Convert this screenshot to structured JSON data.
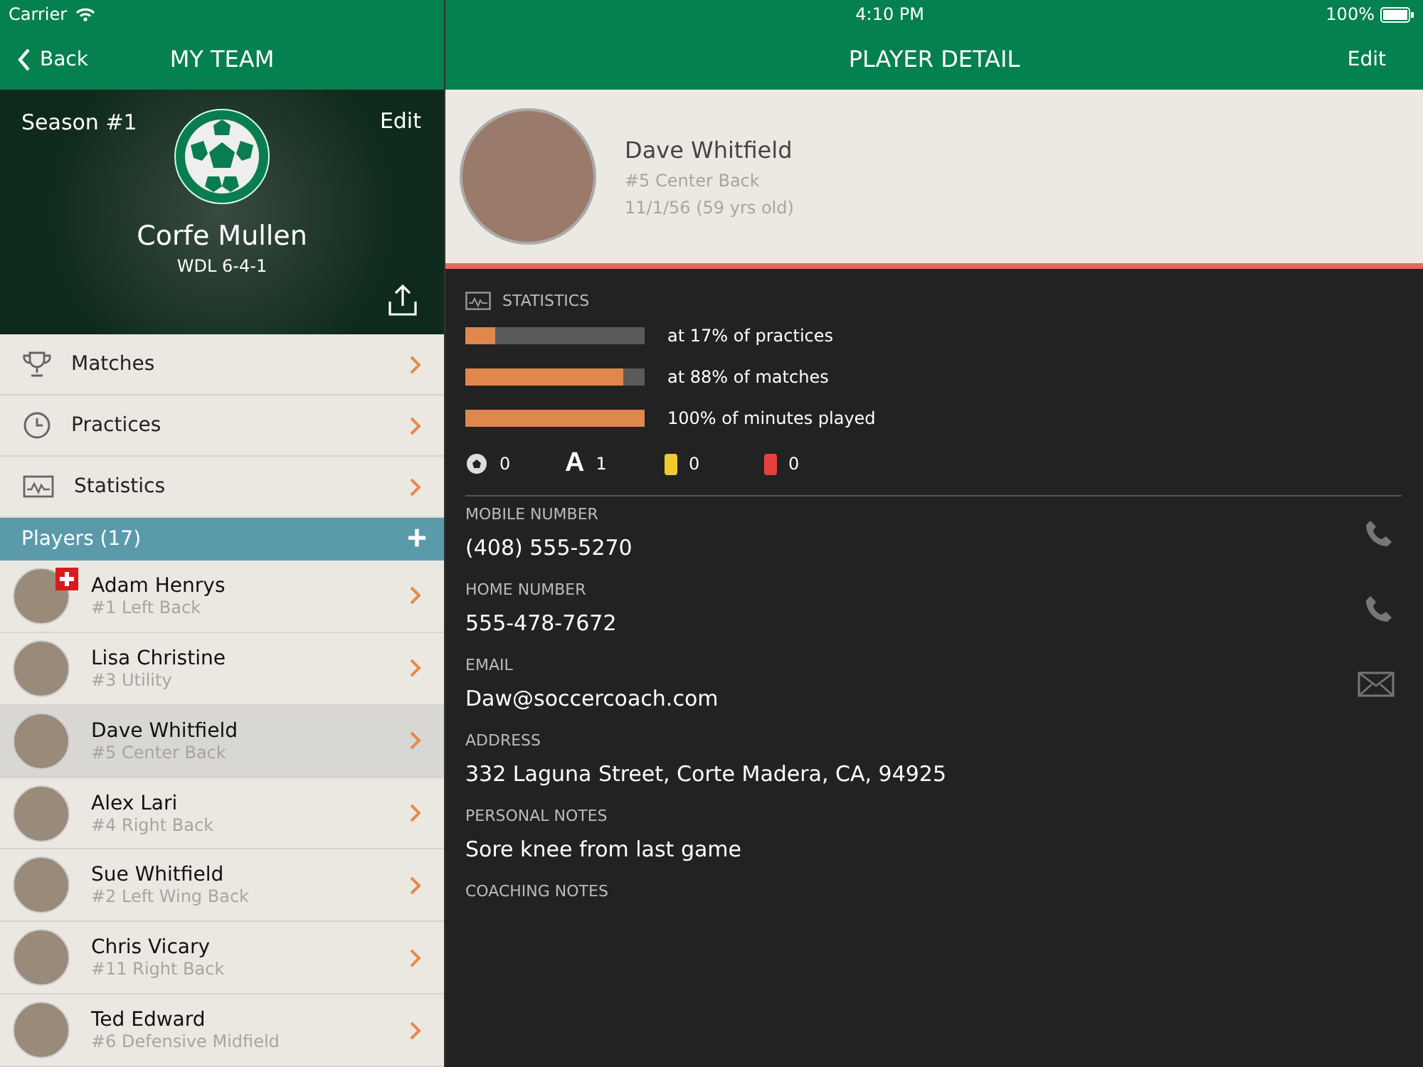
{
  "status_bar": {
    "carrier": "Carrier",
    "time": "4:10 PM",
    "battery": "100%"
  },
  "left_nav": {
    "back": "Back",
    "title": "MY TEAM"
  },
  "team": {
    "season": "Season #1",
    "edit": "Edit",
    "name": "Corfe Mullen",
    "record": "WDL 6-4-1"
  },
  "menu": [
    {
      "kind": "trophy",
      "label": "Matches"
    },
    {
      "kind": "clock",
      "label": "Practices"
    },
    {
      "kind": "chart",
      "label": "Statistics"
    }
  ],
  "players_header": {
    "label": "Players (17)",
    "add": "+"
  },
  "players": [
    {
      "name": "Adam Henrys",
      "position": "#1 Left Back",
      "selected": false,
      "flag": true
    },
    {
      "name": "Lisa Christine",
      "position": "#3 Utility",
      "selected": false,
      "flag": false
    },
    {
      "name": "Dave Whitfield",
      "position": "#5 Center Back",
      "selected": true,
      "flag": false
    },
    {
      "name": "Alex Lari",
      "position": "#4 Right Back",
      "selected": false,
      "flag": false
    },
    {
      "name": "Sue Whitfield",
      "position": "#2 Left Wing Back",
      "selected": false,
      "flag": false
    },
    {
      "name": "Chris Vicary",
      "position": "#11 Right Back",
      "selected": false,
      "flag": false
    },
    {
      "name": "Ted Edward",
      "position": "#6 Defensive Midfield",
      "selected": false,
      "flag": false
    }
  ],
  "detail_nav": {
    "title": "PLAYER DETAIL",
    "edit": "Edit"
  },
  "profile": {
    "name": "Dave Whitfield",
    "position": "#5 Center Back",
    "birth": "11/1/56 (59 yrs old)"
  },
  "statistics": {
    "title": "STATISTICS",
    "bars": [
      {
        "level": 0.17,
        "label": "at 17% of practices"
      },
      {
        "level": 0.88,
        "label": "at 88% of matches"
      },
      {
        "level": 1.0,
        "label": "100% of minutes played"
      }
    ],
    "counters": [
      {
        "kind": "goals",
        "value": "0"
      },
      {
        "kind": "assists",
        "symbol": "A",
        "value": "1"
      },
      {
        "kind": "card",
        "color": "#f2c830",
        "value": "0"
      },
      {
        "kind": "card",
        "color": "#e84040",
        "value": "0"
      }
    ]
  },
  "fields": [
    {
      "label": "MOBILE NUMBER",
      "value": "(408) 555-5270",
      "kind": "phone"
    },
    {
      "label": "HOME NUMBER",
      "value": "555-478-7672",
      "kind": "phone"
    },
    {
      "label": "EMAIL",
      "value": "Daw@soccercoach.com",
      "kind": "mail"
    },
    {
      "label": "ADDRESS",
      "value": "332 Laguna Street, Corte Madera, CA, 94925",
      "kind": "text"
    },
    {
      "label": "PERSONAL NOTES",
      "value": "Sore knee from last game",
      "kind": "text"
    },
    {
      "label": "COACHING NOTES",
      "kind": "text"
    }
  ]
}
